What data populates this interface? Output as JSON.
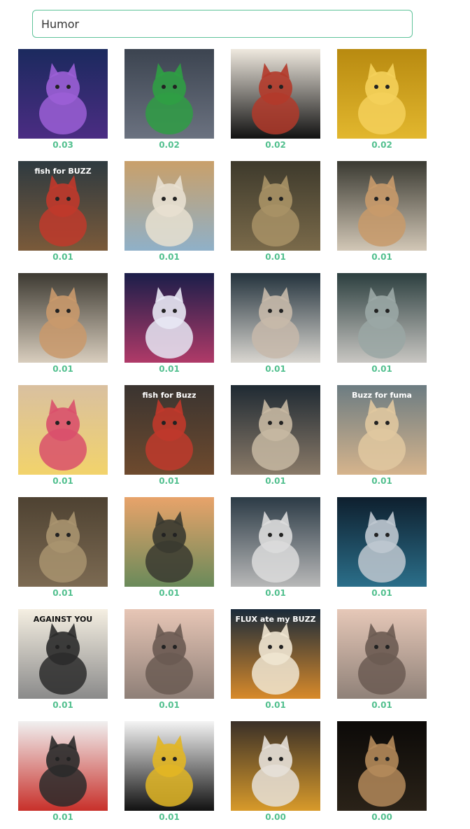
{
  "search": {
    "value": "Humor"
  },
  "results": [
    {
      "score": "0.03",
      "icon": "mystic-cat-image",
      "colors": [
        "#1b2a5e",
        "#4b2c83",
        "#9b5fd6"
      ]
    },
    {
      "score": "0.02",
      "icon": "city-garbage-truck-image",
      "colors": [
        "#3c4450",
        "#6b7280",
        "#2f9e44"
      ]
    },
    {
      "score": "0.02",
      "icon": "ink-creature-image",
      "colors": [
        "#efe9df",
        "#111111",
        "#b23a2a"
      ]
    },
    {
      "score": "0.02",
      "icon": "golden-cat-image",
      "colors": [
        "#b88a10",
        "#e2b72e",
        "#f4d05a"
      ]
    },
    {
      "score": "0.01",
      "icon": "fish-stall-cat-image",
      "colors": [
        "#2e3a40",
        "#7a5a3a",
        "#c0392b"
      ],
      "overlay": "fish for BUZZ"
    },
    {
      "score": "0.01",
      "icon": "playground-kitten-image",
      "colors": [
        "#c9a06a",
        "#8fb0c8",
        "#e8e0d0"
      ]
    },
    {
      "score": "0.01",
      "icon": "tabby-cat-closeup-image",
      "colors": [
        "#3e3a2c",
        "#7a6a4a",
        "#a89266"
      ]
    },
    {
      "score": "0.01",
      "icon": "winged-cat-image",
      "colors": [
        "#3a3a32",
        "#d2c7b6",
        "#c89a6a"
      ]
    },
    {
      "score": "0.01",
      "icon": "winged-cat-image",
      "colors": [
        "#3d3a32",
        "#d8cdbd",
        "#c9996b"
      ]
    },
    {
      "score": "0.01",
      "icon": "neon-city-street-image",
      "colors": [
        "#1b1e4a",
        "#b03a68",
        "#e8e8f4"
      ]
    },
    {
      "score": "0.01",
      "icon": "winged-white-cat-image",
      "colors": [
        "#24333d",
        "#d9d6d0",
        "#c7b9aa"
      ]
    },
    {
      "score": "0.01",
      "icon": "winged-grey-cat-image",
      "colors": [
        "#2c3f3f",
        "#c8c6c2",
        "#9aa7a5"
      ]
    },
    {
      "score": "0.01",
      "icon": "anime-girls-image",
      "colors": [
        "#d9c0a0",
        "#f2d36b",
        "#d9506b"
      ]
    },
    {
      "score": "0.01",
      "icon": "fish-stall-cat-image",
      "colors": [
        "#3a3430",
        "#6e4a2e",
        "#c0392b"
      ],
      "overlay": "fish for Buzz"
    },
    {
      "score": "0.01",
      "icon": "fluffy-cat-image",
      "colors": [
        "#1f2a33",
        "#8a7a68",
        "#c7b8a2"
      ]
    },
    {
      "score": "0.01",
      "icon": "kitten-sign-image",
      "colors": [
        "#6c7c82",
        "#d6b48c",
        "#e0c8a0"
      ],
      "overlay": "Buzz for fuma"
    },
    {
      "score": "0.01",
      "icon": "grumpy-cat-image",
      "colors": [
        "#4e4232",
        "#7c6a52",
        "#a8936f"
      ]
    },
    {
      "score": "0.01",
      "icon": "comic-room-image",
      "colors": [
        "#e8a36a",
        "#6a8a5a",
        "#3a3a30"
      ]
    },
    {
      "score": "0.01",
      "icon": "winged-grey-cat-image",
      "colors": [
        "#2c3b46",
        "#b8b8b8",
        "#dcdcdc"
      ]
    },
    {
      "score": "0.01",
      "icon": "witch-cat-image",
      "colors": [
        "#0e1f2e",
        "#2b6f8a",
        "#bfc8d0"
      ]
    },
    {
      "score": "0.01",
      "icon": "meme-cats-image",
      "colors": [
        "#f5efe2",
        "#8a8a8a",
        "#2b2b2b"
      ],
      "overlay": "AGAINST YOU"
    },
    {
      "score": "0.01",
      "icon": "screaming-cat-image",
      "colors": [
        "#e7c6b6",
        "#8e7f77",
        "#6a5a52"
      ]
    },
    {
      "score": "0.01",
      "icon": "flux-buzz-cat-image",
      "colors": [
        "#1a2a3a",
        "#d88a2a",
        "#f0e6d2"
      ],
      "overlay": "FLUX ate my BUZZ"
    },
    {
      "score": "0.01",
      "icon": "screaming-cat-image",
      "colors": [
        "#e6c8b8",
        "#8f8178",
        "#6b5b52"
      ]
    },
    {
      "score": "0.01",
      "icon": "redhead-anime-girl-image",
      "colors": [
        "#f0f0f0",
        "#c8302a",
        "#2a2a2a"
      ]
    },
    {
      "score": "0.01",
      "icon": "black-cat-image",
      "colors": [
        "#f4f4f4",
        "#111111",
        "#e2b624"
      ]
    },
    {
      "score": "0.00",
      "icon": "cat-in-sweater-image",
      "colors": [
        "#3a3028",
        "#d89a2a",
        "#e6e0d8"
      ]
    },
    {
      "score": "0.00",
      "icon": "shadow-cat-image",
      "colors": [
        "#0c0a08",
        "#2a2218",
        "#b48a5a"
      ]
    }
  ]
}
